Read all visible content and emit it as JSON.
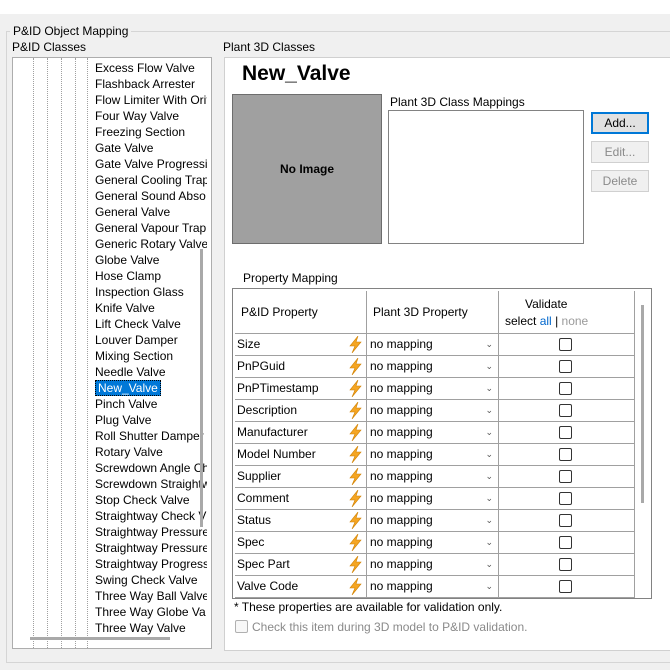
{
  "group_title": "P&ID Object Mapping",
  "left_label": "P&ID Classes",
  "right_label": "Plant 3D Classes",
  "tree_items": [
    "Excess Flow Valve",
    "Flashback Arrester",
    "Flow Limiter With Orif",
    "Four Way Valve",
    "Freezing Section",
    "Gate Valve",
    "Gate Valve Progressi",
    "General Cooling Trap",
    "General Sound Abso",
    "General Valve",
    "General Vapour Trap",
    "Generic Rotary Valve",
    "Globe Valve",
    "Hose Clamp",
    "Inspection Glass",
    "Knife Valve",
    "Lift Check Valve",
    "Louver Damper",
    "Mixing Section",
    "Needle Valve",
    "New_Valve",
    "Pinch Valve",
    "Plug Valve",
    "Roll Shutter Damper",
    "Rotary Valve",
    "Screwdown Angle Ch",
    "Screwdown Straightw",
    "Stop Check Valve",
    "Straightway Check V",
    "Straightway Pressure",
    "Straightway Pressure",
    "Straightway Progress",
    "Swing Check Valve",
    "Three Way Ball Valve",
    "Three Way Globe Va",
    "Three Way Valve"
  ],
  "selected_item": "New_Valve",
  "class_title": "New_Valve",
  "no_image": "No Image",
  "mappings_label": "Plant 3D Class Mappings",
  "buttons": {
    "add": "Add...",
    "edit": "Edit...",
    "delete": "Delete"
  },
  "property_mapping_label": "Property Mapping",
  "grid": {
    "col1": "P&ID Property",
    "col2": "Plant 3D Property",
    "col3_title": "Validate",
    "select_text": "select",
    "all": "all",
    "sep": "|",
    "none": "none"
  },
  "rows": [
    {
      "property": "Size",
      "mapping": "no mapping"
    },
    {
      "property": "PnPGuid",
      "mapping": "no mapping"
    },
    {
      "property": "PnPTimestamp",
      "mapping": "no mapping"
    },
    {
      "property": "Description",
      "mapping": "no mapping"
    },
    {
      "property": "Manufacturer",
      "mapping": "no mapping"
    },
    {
      "property": "Model Number",
      "mapping": "no mapping"
    },
    {
      "property": "Supplier",
      "mapping": "no mapping"
    },
    {
      "property": "Comment",
      "mapping": "no mapping"
    },
    {
      "property": "Status",
      "mapping": "no mapping"
    },
    {
      "property": "Spec",
      "mapping": "no mapping"
    },
    {
      "property": "Spec Part",
      "mapping": "no mapping"
    },
    {
      "property": "Valve Code",
      "mapping": "no mapping"
    }
  ],
  "note": "* These properties are available for validation only.",
  "validation_checkbox_label": "Check this item during 3D model to P&ID validation.",
  "colors": {
    "selection": "#0078d7",
    "bolt": "#f5a623",
    "link": "#0066cc"
  },
  "icons": {
    "row_icon": "lightning-bolt-icon",
    "dropdown": "chevron-down-icon"
  }
}
